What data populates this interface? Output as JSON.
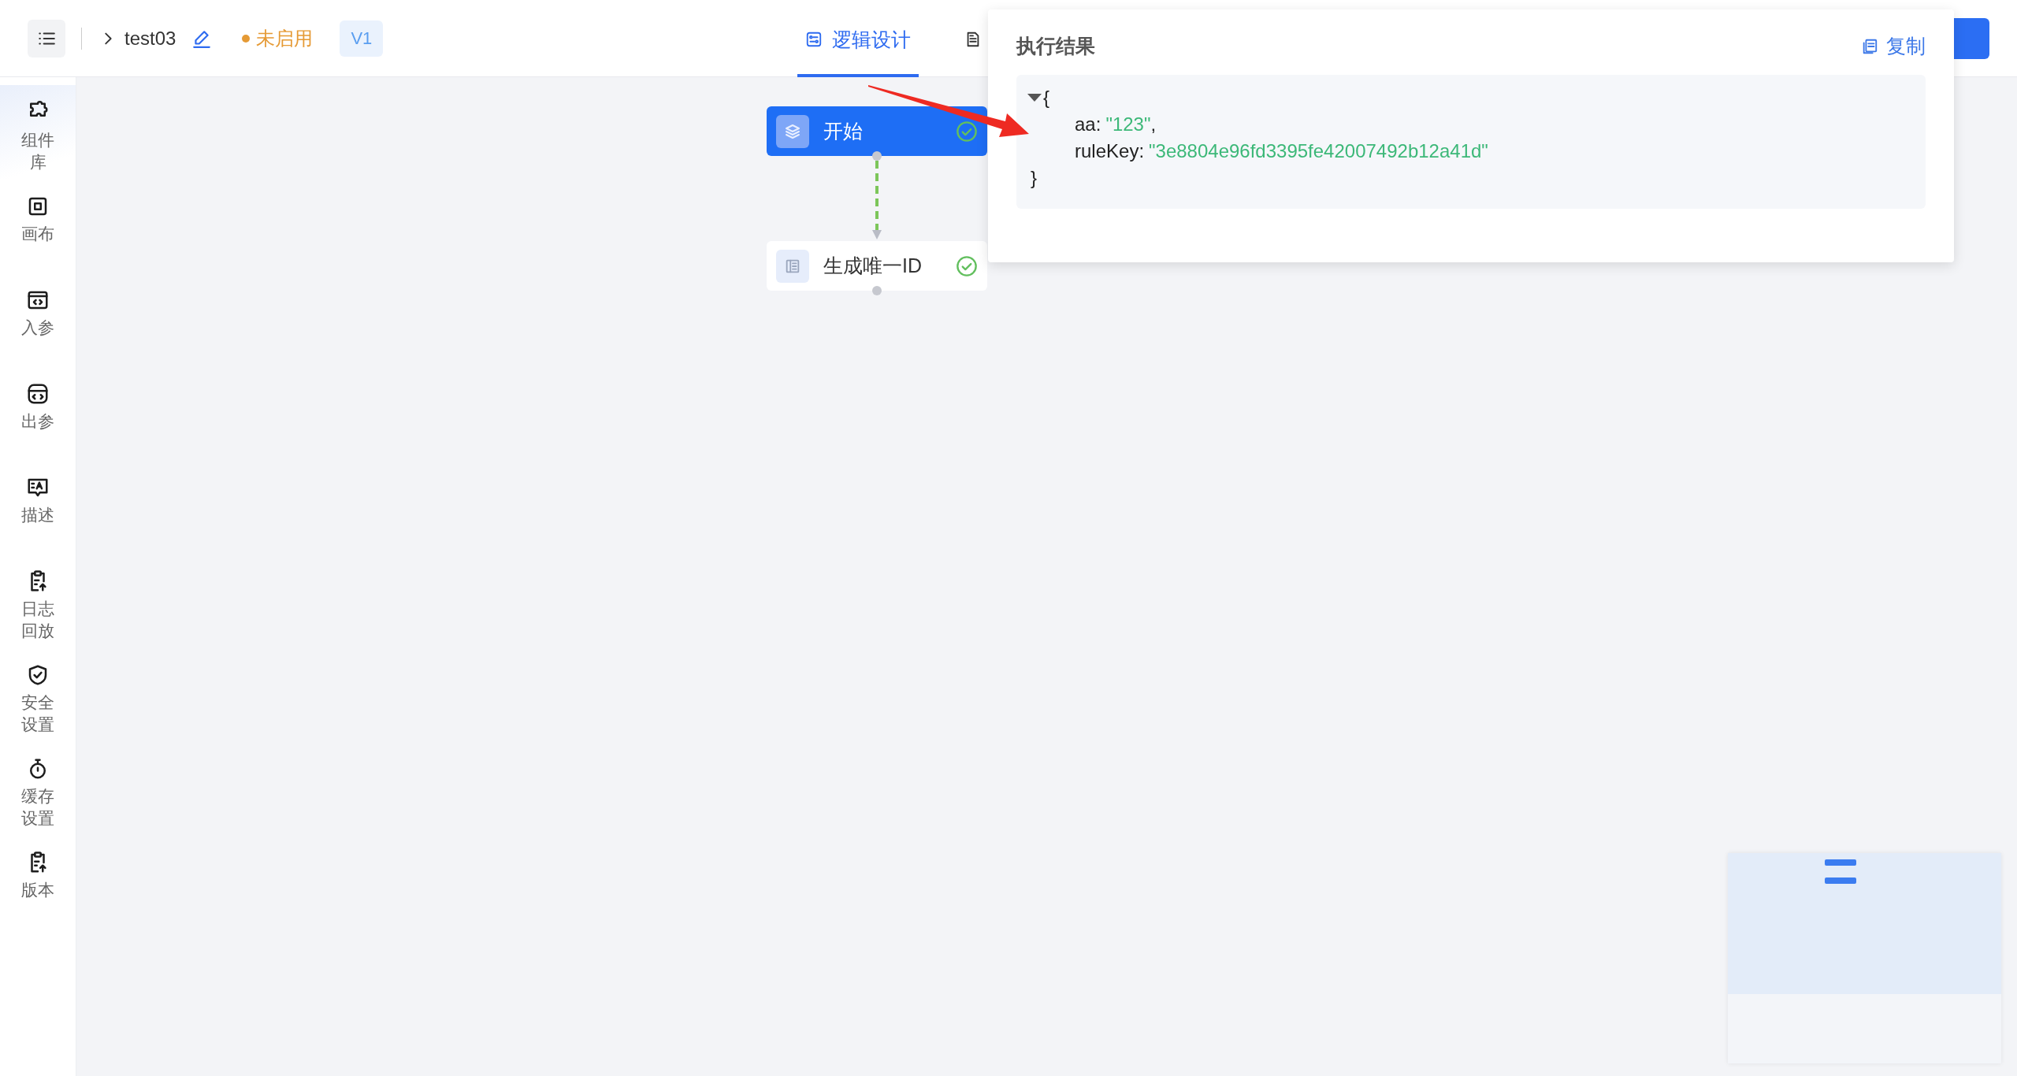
{
  "header": {
    "title": "test03",
    "status": {
      "label": "未启用",
      "color": "#e59a35"
    },
    "version": "V1"
  },
  "tabs": [
    {
      "label": "逻辑设计",
      "selected": true
    },
    {
      "selected": false
    }
  ],
  "sidebar": {
    "items": [
      {
        "kind": "component",
        "label": "组件库",
        "selected": true
      },
      {
        "kind": "canvas",
        "label": "画布",
        "selected": false
      },
      {
        "kind": "input",
        "label": "入参",
        "selected": false
      },
      {
        "kind": "output",
        "label": "出参",
        "selected": false
      },
      {
        "kind": "description",
        "label": "描述",
        "selected": false
      },
      {
        "kind": "log",
        "label": "日志回放",
        "selected": false
      },
      {
        "kind": "security",
        "label": "安全设置",
        "selected": false
      },
      {
        "kind": "cache",
        "label": "缓存设置",
        "selected": false
      },
      {
        "kind": "version",
        "label": "版本",
        "selected": false
      }
    ]
  },
  "flow": {
    "nodes": [
      {
        "kind": "start",
        "label": "开始",
        "selected": true,
        "succeeded": true
      },
      {
        "kind": "step",
        "label": "生成唯一ID",
        "selected": false,
        "succeeded": true
      }
    ]
  },
  "result_panel": {
    "title": "执行结果",
    "copy_label": "复制",
    "expanded": true,
    "open_brace": "{",
    "close_brace": "}",
    "fields": [
      {
        "key": "aa:",
        "value": "\"123\"",
        "trail": ","
      },
      {
        "key": "ruleKey:",
        "value": "\"3e8804e96fd3395fe42007492b12a41d\""
      }
    ]
  }
}
